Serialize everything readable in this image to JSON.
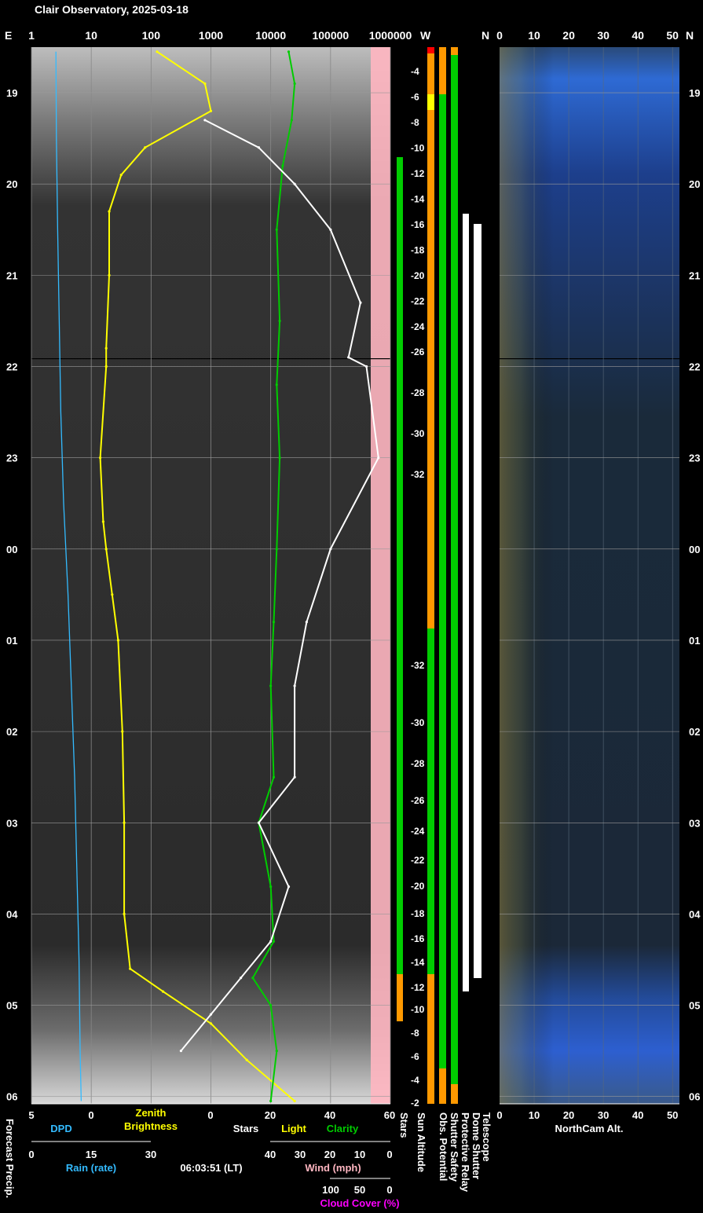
{
  "title": "Clair Observatory, 2025-03-18",
  "time_label": "06:03:51 (LT)",
  "colors": {
    "white": "#ffffff",
    "yellow": "#ffff00",
    "orange": "#ff9900",
    "green": "#00cc00",
    "cyan": "#33bbff",
    "pink": "#ffb6c1",
    "magenta": "#ff00ff",
    "red": "#ff0000"
  },
  "top_axis": {
    "left_marker": "E",
    "labels": [
      "1",
      "10",
      "100",
      "1000",
      "10000",
      "100000",
      "1000000"
    ],
    "w_label": "W",
    "n_label": "N",
    "alt_labels": [
      "0",
      "10",
      "20",
      "30",
      "40",
      "50"
    ],
    "right_marker": "N"
  },
  "hour_labels": [
    "19",
    "20",
    "21",
    "22",
    "23",
    "00",
    "01",
    "02",
    "03",
    "04",
    "05",
    "06"
  ],
  "sun_altitude_upper": [
    "-4",
    "-6",
    "-8",
    "-10",
    "-12",
    "-14",
    "-16",
    "-18",
    "-20",
    "-22",
    "-24",
    "-26",
    "-28",
    "-30",
    "-32"
  ],
  "sun_altitude_lower": [
    "-32",
    "-30",
    "-28",
    "-26",
    "-24",
    "-22",
    "-20",
    "-18",
    "-16",
    "-14",
    "-12",
    "-10",
    "-8",
    "-6",
    "-4",
    "-2"
  ],
  "bottom": {
    "dpd_ticks": [
      "5",
      "0"
    ],
    "dpd_label": "DPD",
    "zenith_label_1": "Zenith",
    "zenith_label_2": "Brightness",
    "stars_ticks": [
      "0",
      "20",
      "40",
      "60"
    ],
    "stars_label": "Stars",
    "light_label": "Light",
    "clarity_label": "Clarity",
    "rain_ticks": [
      "0",
      "15",
      "30"
    ],
    "rain_label": "Rain (rate)",
    "wind_ticks": [
      "40",
      "30",
      "20",
      "10",
      "0"
    ],
    "wind_label": "Wind (mph)",
    "cloud_ticks": [
      "100",
      "50",
      "0"
    ],
    "cloud_label": "Cloud Cover (%)",
    "forecast_label": "Forecast Precip.",
    "vertical_labels": [
      "Stars",
      "Sun Altitude",
      "Obs. Potential",
      "Shutter Safety",
      "Protective Relay",
      "Dome Shutter",
      "Telescope"
    ],
    "northcam_ticks": [
      "0",
      "10",
      "20",
      "30",
      "40",
      "50"
    ],
    "northcam_label": "NorthCam Alt."
  },
  "chart_data": {
    "type": "line",
    "x_axis": "hours (LT)",
    "y_axis": "time from 18:30 to 06:05 (LT)",
    "series": [
      {
        "name": "Zenith Brightness",
        "color": "#ffff00",
        "points": [
          [
            18.55,
            2.1
          ],
          [
            18.9,
            2.9
          ],
          [
            19.2,
            3.0
          ],
          [
            19.6,
            1.9
          ],
          [
            19.9,
            1.5
          ],
          [
            20.3,
            1.3
          ],
          [
            21.0,
            1.3
          ],
          [
            21.8,
            1.25
          ],
          [
            22.0,
            1.25
          ],
          [
            23.0,
            1.15
          ],
          [
            23.7,
            1.2
          ],
          [
            0.0,
            1.25
          ],
          [
            0.5,
            1.35
          ],
          [
            1.0,
            1.45
          ],
          [
            2.0,
            1.52
          ],
          [
            3.0,
            1.55
          ],
          [
            4.0,
            1.55
          ],
          [
            4.6,
            1.65
          ],
          [
            4.85,
            2.2
          ],
          [
            5.2,
            3.0
          ],
          [
            5.6,
            3.6
          ],
          [
            6.05,
            4.4
          ]
        ]
      },
      {
        "name": "Clarity",
        "color": "#00cc00",
        "points": [
          [
            18.55,
            4.3
          ],
          [
            18.9,
            4.4
          ],
          [
            19.3,
            4.35
          ],
          [
            19.8,
            4.2
          ],
          [
            20.5,
            4.1
          ],
          [
            21.5,
            4.15
          ],
          [
            22.2,
            4.1
          ],
          [
            23.0,
            4.15
          ],
          [
            0.0,
            4.1
          ],
          [
            0.8,
            4.05
          ],
          [
            1.5,
            4.0
          ],
          [
            2.5,
            4.05
          ],
          [
            3.0,
            3.8
          ],
          [
            3.7,
            4.0
          ],
          [
            4.3,
            4.05
          ],
          [
            4.7,
            3.7
          ],
          [
            5.0,
            4.0
          ],
          [
            5.5,
            4.1
          ],
          [
            6.05,
            4.0
          ]
        ]
      },
      {
        "name": "Stars",
        "color": "#ffffff",
        "points": [
          [
            19.3,
            2.9
          ],
          [
            19.6,
            3.8
          ],
          [
            20.0,
            4.4
          ],
          [
            20.5,
            5.0
          ],
          [
            21.3,
            5.5
          ],
          [
            21.9,
            5.3
          ],
          [
            22.0,
            5.6
          ],
          [
            23.0,
            5.8
          ],
          [
            0.0,
            5.0
          ],
          [
            0.8,
            4.6
          ],
          [
            1.5,
            4.4
          ],
          [
            2.5,
            4.4
          ],
          [
            3.0,
            3.8
          ],
          [
            3.7,
            4.3
          ],
          [
            4.3,
            4.0
          ],
          [
            4.7,
            3.5
          ],
          [
            5.1,
            3.0
          ],
          [
            5.5,
            2.5
          ]
        ]
      }
    ]
  }
}
